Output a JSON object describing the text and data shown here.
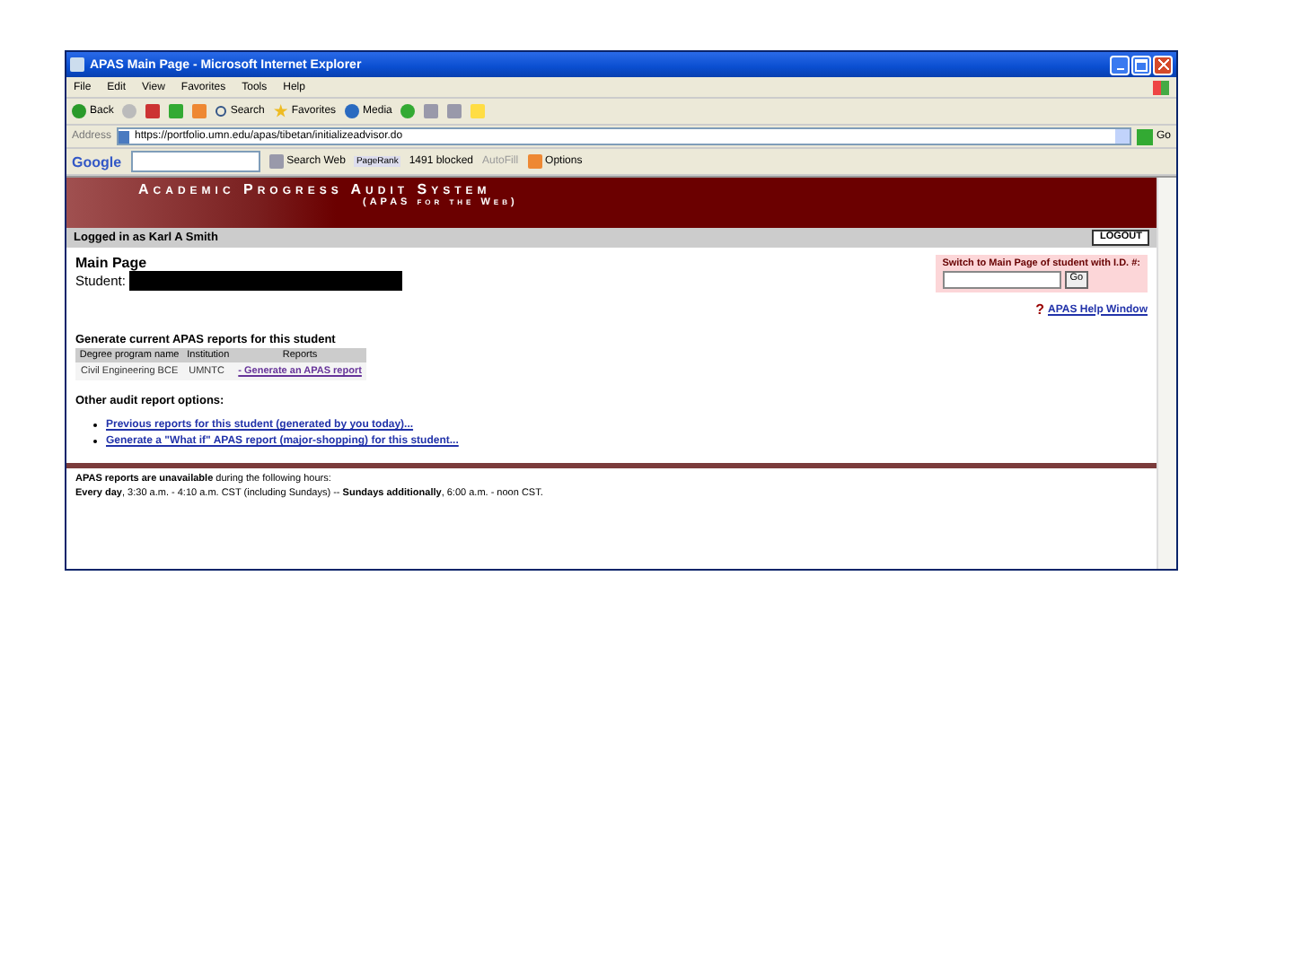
{
  "window": {
    "title": "APAS Main Page - Microsoft Internet Explorer"
  },
  "menu": [
    "File",
    "Edit",
    "View",
    "Favorites",
    "Tools",
    "Help"
  ],
  "toolbar": {
    "back": "Back",
    "search": "Search",
    "favorites": "Favorites",
    "media": "Media"
  },
  "address": {
    "label": "Address",
    "url": "https://portfolio.umn.edu/apas/tibetan/initializeadvisor.do",
    "go": "Go"
  },
  "google_bar": {
    "logo": "Google",
    "search": "Search Web",
    "pagerank": "PageRank",
    "blocked": "1491 blocked",
    "autofill": "AutoFill",
    "options": "Options"
  },
  "banner": {
    "title": "Academic Progress Audit System",
    "subtitle": "(APAS for the Web)"
  },
  "user_bar": {
    "text": "Logged in as Karl A Smith",
    "logout": "LOGOUT"
  },
  "heading": "Main Page",
  "student_label": "Student:",
  "switch": {
    "label": "Switch to Main Page of student with I.D. #:",
    "button": "Go"
  },
  "help_icon": "?",
  "help_link": "APAS Help Window",
  "reports": {
    "title": "Generate current APAS reports for this student",
    "columns": [
      "Degree program name",
      "Institution",
      "Reports"
    ],
    "rows": [
      {
        "program": "Civil Engineering BCE",
        "institution": "UMNTC",
        "link": "- Generate an APAS report"
      }
    ]
  },
  "other": {
    "title": "Other audit report options:",
    "links": [
      "Previous reports for this student (generated by you today)...",
      "Generate a \"What if\" APAS report (major-shopping) for this student..."
    ]
  },
  "footer": [
    "**APAS reports are unavailable** during the following hours:",
    "**Every day**, 3:30 a.m. - 4:10 a.m. CST (including Sundays)  --  **Sundays additionally**, 6:00 a.m. - noon CST."
  ]
}
